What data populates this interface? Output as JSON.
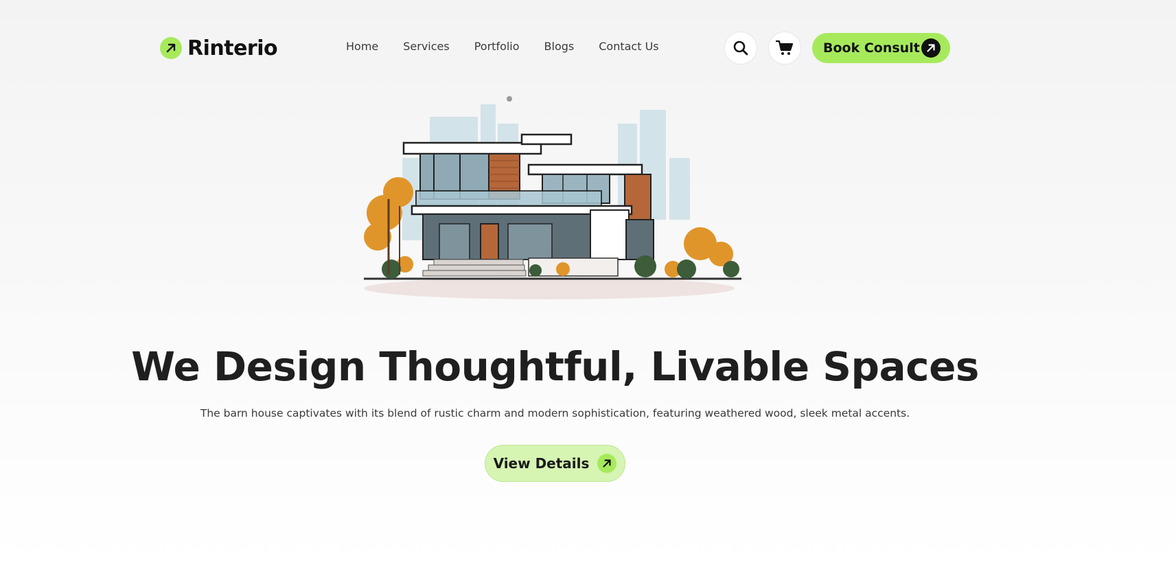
{
  "brand": {
    "name": "Rinterio",
    "accent_color": "#a6ea5c",
    "logo_icon": "arrow-up-right-icon"
  },
  "nav": {
    "items": [
      {
        "label": "Home"
      },
      {
        "label": "Services"
      },
      {
        "label": "Portfolio"
      },
      {
        "label": "Blogs"
      },
      {
        "label": "Contact Us"
      }
    ]
  },
  "header_actions": {
    "search_icon": "search-icon",
    "cart_icon": "cart-icon",
    "consult_label": "Book Consult",
    "consult_icon": "arrow-up-right-icon"
  },
  "hero": {
    "illustration": "modern-house-illustration",
    "title": "We Design Thoughtful, Livable Spaces",
    "subtitle": "The barn house captivates with its blend of rustic charm and modern sophistication, featuring weathered wood, sleek metal accents.",
    "cta_label": "View Details",
    "cta_icon": "arrow-up-right-icon"
  }
}
